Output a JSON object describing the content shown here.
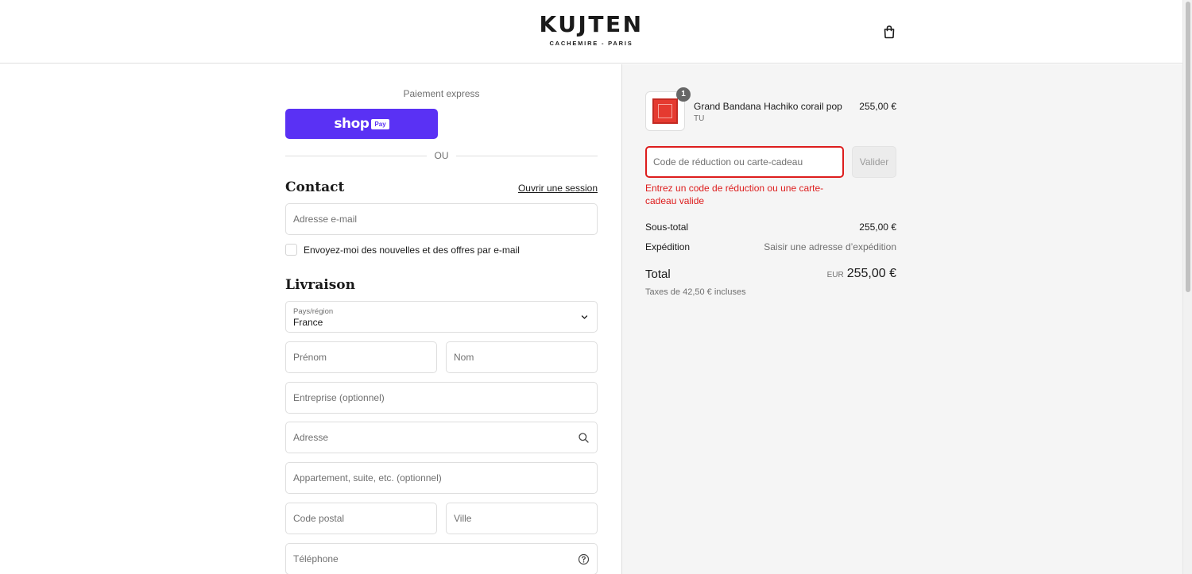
{
  "header": {
    "brand": "KUJTEN",
    "tagline": "CACHEMIRE - PARIS",
    "cart_icon": "shopping-bag-icon"
  },
  "express": {
    "label": "Paiement express",
    "shop_word": "shop",
    "pay_word": "Pay",
    "divider_text": "OU"
  },
  "contact": {
    "title": "Contact",
    "login_link": "Ouvrir une session",
    "email_placeholder": "Adresse e-mail",
    "newsletter_label": "Envoyez-moi des nouvelles et des offres par e-mail"
  },
  "delivery": {
    "title": "Livraison",
    "country_label": "Pays/région",
    "country_value": "France",
    "first_name_placeholder": "Prénom",
    "last_name_placeholder": "Nom",
    "company_placeholder": "Entreprise (optionnel)",
    "address_placeholder": "Adresse",
    "apartment_placeholder": "Appartement, suite, etc. (optionnel)",
    "postal_code_placeholder": "Code postal",
    "city_placeholder": "Ville",
    "phone_placeholder": "Téléphone"
  },
  "summary": {
    "product": {
      "name": "Grand Bandana Hachiko corail pop",
      "variant": "TU",
      "price": "255,00 €",
      "quantity": "1"
    },
    "discount_placeholder": "Code de réduction ou carte-cadeau",
    "apply_label": "Valider",
    "error_message": "Entrez un code de réduction ou une carte-cadeau valide",
    "subtotal_label": "Sous-total",
    "subtotal_value": "255,00 €",
    "shipping_label": "Expédition",
    "shipping_value": "Saisir une adresse d’expédition",
    "total_label": "Total",
    "total_currency": "EUR",
    "total_value": "255,00 €",
    "taxes_note": "Taxes de 42,50 € incluses"
  },
  "colors": {
    "shop_pay": "#5a31f4",
    "error": "#dd1d1d",
    "summary_bg": "#f5f5f5",
    "product_red": "#e53a30"
  }
}
